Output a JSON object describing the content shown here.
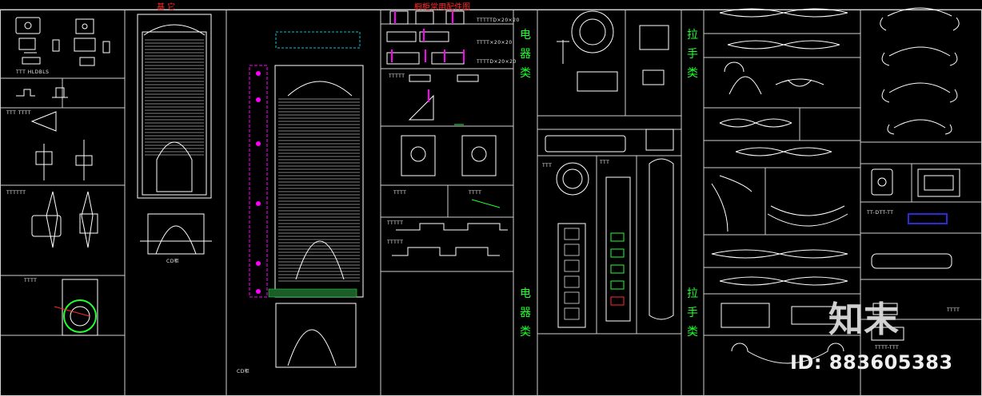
{
  "sheet": {
    "title_left": "基 它",
    "title_hardware": "橱柜常用配件图",
    "category_electric": "电器类",
    "category_handle": "拉手类",
    "label_cd_left": "CD柜",
    "label_cd_middle": "CD柜",
    "dim_a": "TTTTTD×20×20",
    "dim_b": "TTTT×20×20",
    "dim_c": "TTTTD×20×20",
    "code_lock": "TTT HLDBLS",
    "label_slide": "TTT TTTT",
    "label_small_a": "TTTT",
    "label_small_b": "TTTTTT",
    "label_small_c": "TTTTT",
    "label_drawer_a": "TTTTT",
    "label_drawer_b": "TTTTT",
    "label_rail_a": "TTTT",
    "label_rail_b": "TTTT",
    "label_elec_a": "TTT",
    "label_elec_b": "TTT",
    "label_handle_a": "TT-DTT-TT",
    "label_handle_b": "TTTT",
    "label_handle_c": "TTTT-TTT",
    "watermark_logo": "知末",
    "watermark_id": "ID: 883605383"
  },
  "colors": {
    "background": "#000000",
    "line": "#ffffff",
    "frame": "#cfcfcf",
    "magenta": "#ff00ff",
    "cyan": "#00c8d8",
    "red": "#ff2a2a",
    "green": "#20ff30"
  }
}
